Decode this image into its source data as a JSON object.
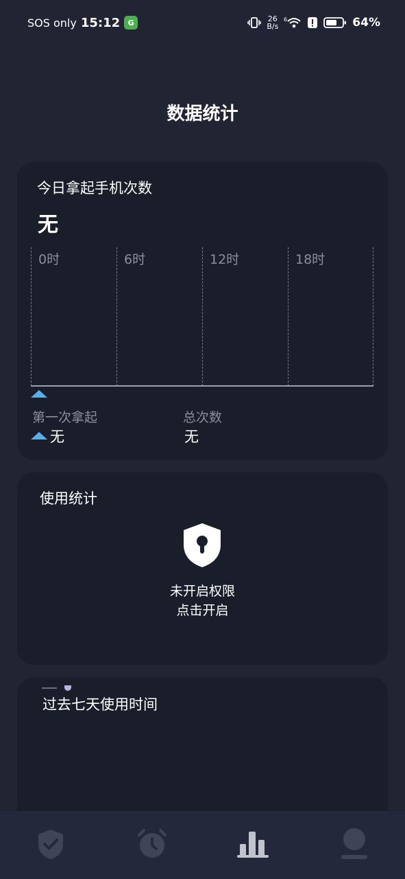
{
  "status_bar": {
    "network_label": "SOS only",
    "time": "15:12",
    "app_icon_letter": "G",
    "net_speed_value": "26",
    "net_speed_unit": "B/s",
    "wifi_super": "6",
    "battery": "64%"
  },
  "page": {
    "title": "数据统计"
  },
  "pickup_card": {
    "title": "今日拿起手机次数",
    "value": "无",
    "chart_ticks": [
      "0时",
      "6时",
      "12时",
      "18时"
    ],
    "first_pickup_label": "第一次拿起",
    "first_pickup_value": "无",
    "total_label": "总次数",
    "total_value": "无"
  },
  "usage_card": {
    "title": "使用统计",
    "lock_line1": "未开启权限",
    "lock_line2": "点击开启"
  },
  "weekly_card": {
    "title": "过去七天使用时间"
  },
  "colors": {
    "background": "#212533",
    "card": "#1a1e2b",
    "accent_marker": "#5aaee8",
    "muted_text": "#8a8f9c",
    "nav_icon": "#3f4556",
    "nav_icon_active": "#bfc3ce"
  },
  "nav": {
    "items": [
      {
        "icon": "shield-check-icon",
        "active": false
      },
      {
        "icon": "alarm-clock-icon",
        "active": false
      },
      {
        "icon": "bar-chart-icon",
        "active": true
      },
      {
        "icon": "profile-icon",
        "active": false
      }
    ]
  }
}
